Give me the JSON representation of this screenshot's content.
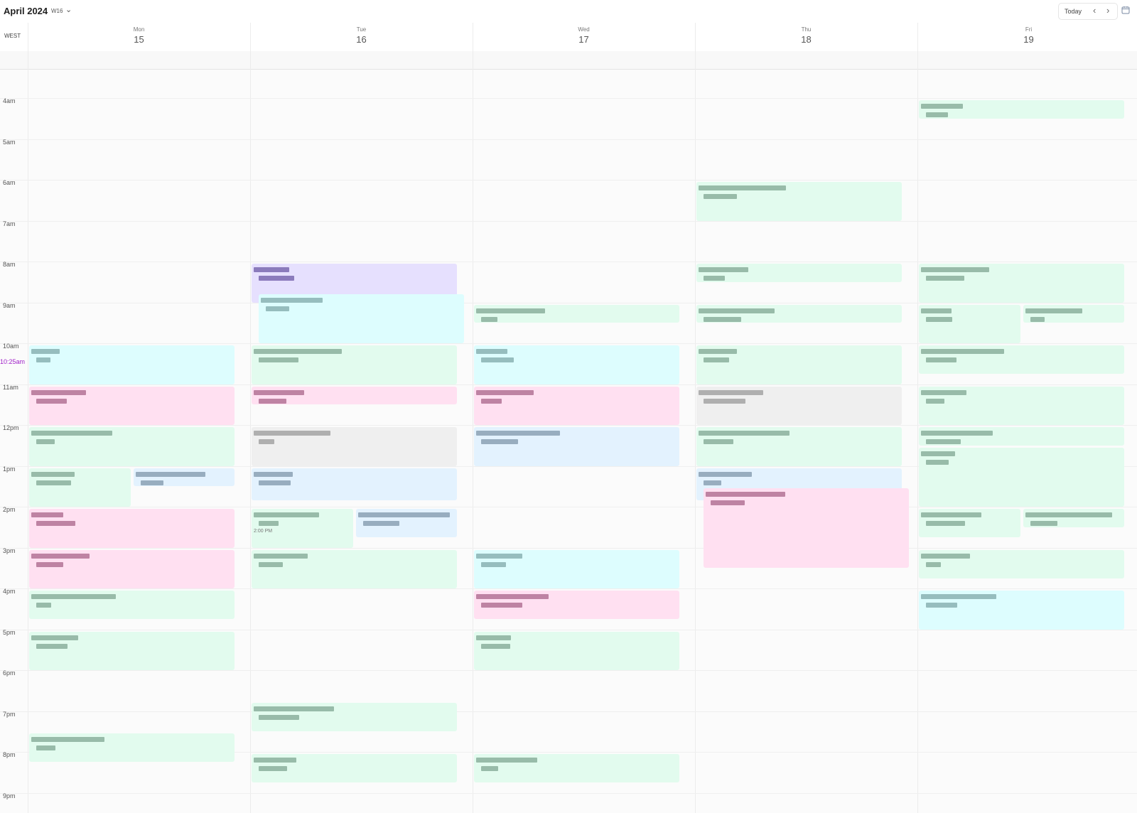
{
  "header": {
    "title": "April 2024",
    "week": "W16",
    "today_label": "Today",
    "prev_icon": "‹",
    "next_icon": "›",
    "timezone": "WEST"
  },
  "days": [
    {
      "name": "Mon",
      "num": "15"
    },
    {
      "name": "Tue",
      "num": "16"
    },
    {
      "name": "Wed",
      "num": "17"
    },
    {
      "name": "Thu",
      "num": "18"
    },
    {
      "name": "Fri",
      "num": "19"
    }
  ],
  "hours": [
    "4am",
    "5am",
    "6am",
    "7am",
    "8am",
    "9am",
    "10am",
    "11am",
    "12pm",
    "1pm",
    "2pm",
    "3pm",
    "4pm",
    "5pm",
    "6pm",
    "7pm",
    "8pm",
    "9pm"
  ],
  "current_time": "10:25am",
  "events": [
    {
      "day": 0,
      "col": 0,
      "cols": 1,
      "start": 10.0,
      "end": 11.0,
      "color": "cyan"
    },
    {
      "day": 0,
      "col": 0,
      "cols": 1,
      "start": 11.0,
      "end": 12.0,
      "color": "pink"
    },
    {
      "day": 0,
      "col": 0,
      "cols": 1,
      "start": 12.0,
      "end": 13.0,
      "color": "green"
    },
    {
      "day": 0,
      "col": 0,
      "cols": 2,
      "start": 13.0,
      "end": 14.0,
      "color": "green"
    },
    {
      "day": 0,
      "col": 1,
      "cols": 2,
      "start": 13.0,
      "end": 13.5,
      "color": "blue"
    },
    {
      "day": 0,
      "col": 0,
      "cols": 1,
      "start": 14.0,
      "end": 15.0,
      "color": "pink"
    },
    {
      "day": 0,
      "col": 0,
      "cols": 1,
      "start": 15.0,
      "end": 16.0,
      "color": "pink"
    },
    {
      "day": 0,
      "col": 0,
      "cols": 1,
      "start": 16.0,
      "end": 16.75,
      "color": "green"
    },
    {
      "day": 0,
      "col": 0,
      "cols": 1,
      "start": 17.0,
      "end": 18.0,
      "color": "green"
    },
    {
      "day": 0,
      "col": 0,
      "cols": 1,
      "start": 19.5,
      "end": 20.25,
      "color": "green"
    },
    {
      "day": 1,
      "col": 0,
      "cols": 1,
      "start": 8.0,
      "end": 9.0,
      "color": "purple"
    },
    {
      "day": 1,
      "col": 0,
      "cols": 1,
      "start": 8.75,
      "end": 10.0,
      "color": "cyan",
      "indent": true
    },
    {
      "day": 1,
      "col": 0,
      "cols": 1,
      "start": 10.0,
      "end": 11.0,
      "color": "green"
    },
    {
      "day": 1,
      "col": 0,
      "cols": 1,
      "start": 11.0,
      "end": 11.5,
      "color": "pink"
    },
    {
      "day": 1,
      "col": 0,
      "cols": 1,
      "start": 12.0,
      "end": 13.0,
      "color": "grey"
    },
    {
      "day": 1,
      "col": 0,
      "cols": 1,
      "start": 13.0,
      "end": 13.85,
      "color": "blue"
    },
    {
      "day": 1,
      "col": 0,
      "cols": 2,
      "start": 14.0,
      "end": 15.0,
      "color": "green",
      "time": "2:00 PM"
    },
    {
      "day": 1,
      "col": 1,
      "cols": 2,
      "start": 14.0,
      "end": 14.75,
      "color": "blue"
    },
    {
      "day": 1,
      "col": 0,
      "cols": 1,
      "start": 15.0,
      "end": 16.0,
      "color": "green"
    },
    {
      "day": 1,
      "col": 0,
      "cols": 1,
      "start": 18.75,
      "end": 19.5,
      "color": "green"
    },
    {
      "day": 1,
      "col": 0,
      "cols": 1,
      "start": 20.0,
      "end": 20.75,
      "color": "green"
    },
    {
      "day": 2,
      "col": 0,
      "cols": 1,
      "start": 9.0,
      "end": 9.5,
      "color": "green"
    },
    {
      "day": 2,
      "col": 0,
      "cols": 1,
      "start": 10.0,
      "end": 11.0,
      "color": "cyan"
    },
    {
      "day": 2,
      "col": 0,
      "cols": 1,
      "start": 11.0,
      "end": 12.0,
      "color": "pink"
    },
    {
      "day": 2,
      "col": 0,
      "cols": 1,
      "start": 12.0,
      "end": 13.0,
      "color": "blue"
    },
    {
      "day": 2,
      "col": 0,
      "cols": 1,
      "start": 15.0,
      "end": 16.0,
      "color": "cyan"
    },
    {
      "day": 2,
      "col": 0,
      "cols": 1,
      "start": 16.0,
      "end": 16.75,
      "color": "pink"
    },
    {
      "day": 2,
      "col": 0,
      "cols": 1,
      "start": 17.0,
      "end": 18.0,
      "color": "green"
    },
    {
      "day": 2,
      "col": 0,
      "cols": 1,
      "start": 20.0,
      "end": 20.75,
      "color": "green"
    },
    {
      "day": 3,
      "col": 0,
      "cols": 1,
      "start": 6.0,
      "end": 7.0,
      "color": "green"
    },
    {
      "day": 3,
      "col": 0,
      "cols": 1,
      "start": 8.0,
      "end": 8.5,
      "color": "green"
    },
    {
      "day": 3,
      "col": 0,
      "cols": 1,
      "start": 9.0,
      "end": 9.5,
      "color": "green"
    },
    {
      "day": 3,
      "col": 0,
      "cols": 1,
      "start": 10.0,
      "end": 11.0,
      "color": "green"
    },
    {
      "day": 3,
      "col": 0,
      "cols": 1,
      "start": 11.0,
      "end": 12.0,
      "color": "grey"
    },
    {
      "day": 3,
      "col": 0,
      "cols": 1,
      "start": 12.0,
      "end": 13.0,
      "color": "green"
    },
    {
      "day": 3,
      "col": 0,
      "cols": 1,
      "start": 13.0,
      "end": 13.85,
      "color": "blue"
    },
    {
      "day": 3,
      "col": 0,
      "cols": 1,
      "start": 13.5,
      "end": 15.5,
      "color": "pink",
      "indent": true
    },
    {
      "day": 4,
      "col": 0,
      "cols": 1,
      "start": 4.0,
      "end": 4.5,
      "color": "green"
    },
    {
      "day": 4,
      "col": 0,
      "cols": 1,
      "start": 8.0,
      "end": 9.0,
      "color": "green"
    },
    {
      "day": 4,
      "col": 0,
      "cols": 2,
      "start": 9.0,
      "end": 10.0,
      "color": "green"
    },
    {
      "day": 4,
      "col": 1,
      "cols": 2,
      "start": 9.0,
      "end": 9.5,
      "color": "green"
    },
    {
      "day": 4,
      "col": 0,
      "cols": 1,
      "start": 10.0,
      "end": 10.75,
      "color": "green"
    },
    {
      "day": 4,
      "col": 0,
      "cols": 1,
      "start": 11.0,
      "end": 12.0,
      "color": "green"
    },
    {
      "day": 4,
      "col": 0,
      "cols": 1,
      "start": 12.0,
      "end": 12.5,
      "color": "green"
    },
    {
      "day": 4,
      "col": 0,
      "cols": 1,
      "start": 12.5,
      "end": 14.0,
      "color": "green"
    },
    {
      "day": 4,
      "col": 0,
      "cols": 2,
      "start": 14.0,
      "end": 14.75,
      "color": "green"
    },
    {
      "day": 4,
      "col": 1,
      "cols": 2,
      "start": 14.0,
      "end": 14.5,
      "color": "green"
    },
    {
      "day": 4,
      "col": 0,
      "cols": 1,
      "start": 15.0,
      "end": 15.75,
      "color": "green"
    },
    {
      "day": 4,
      "col": 0,
      "cols": 1,
      "start": 16.0,
      "end": 17.0,
      "color": "cyan"
    }
  ]
}
